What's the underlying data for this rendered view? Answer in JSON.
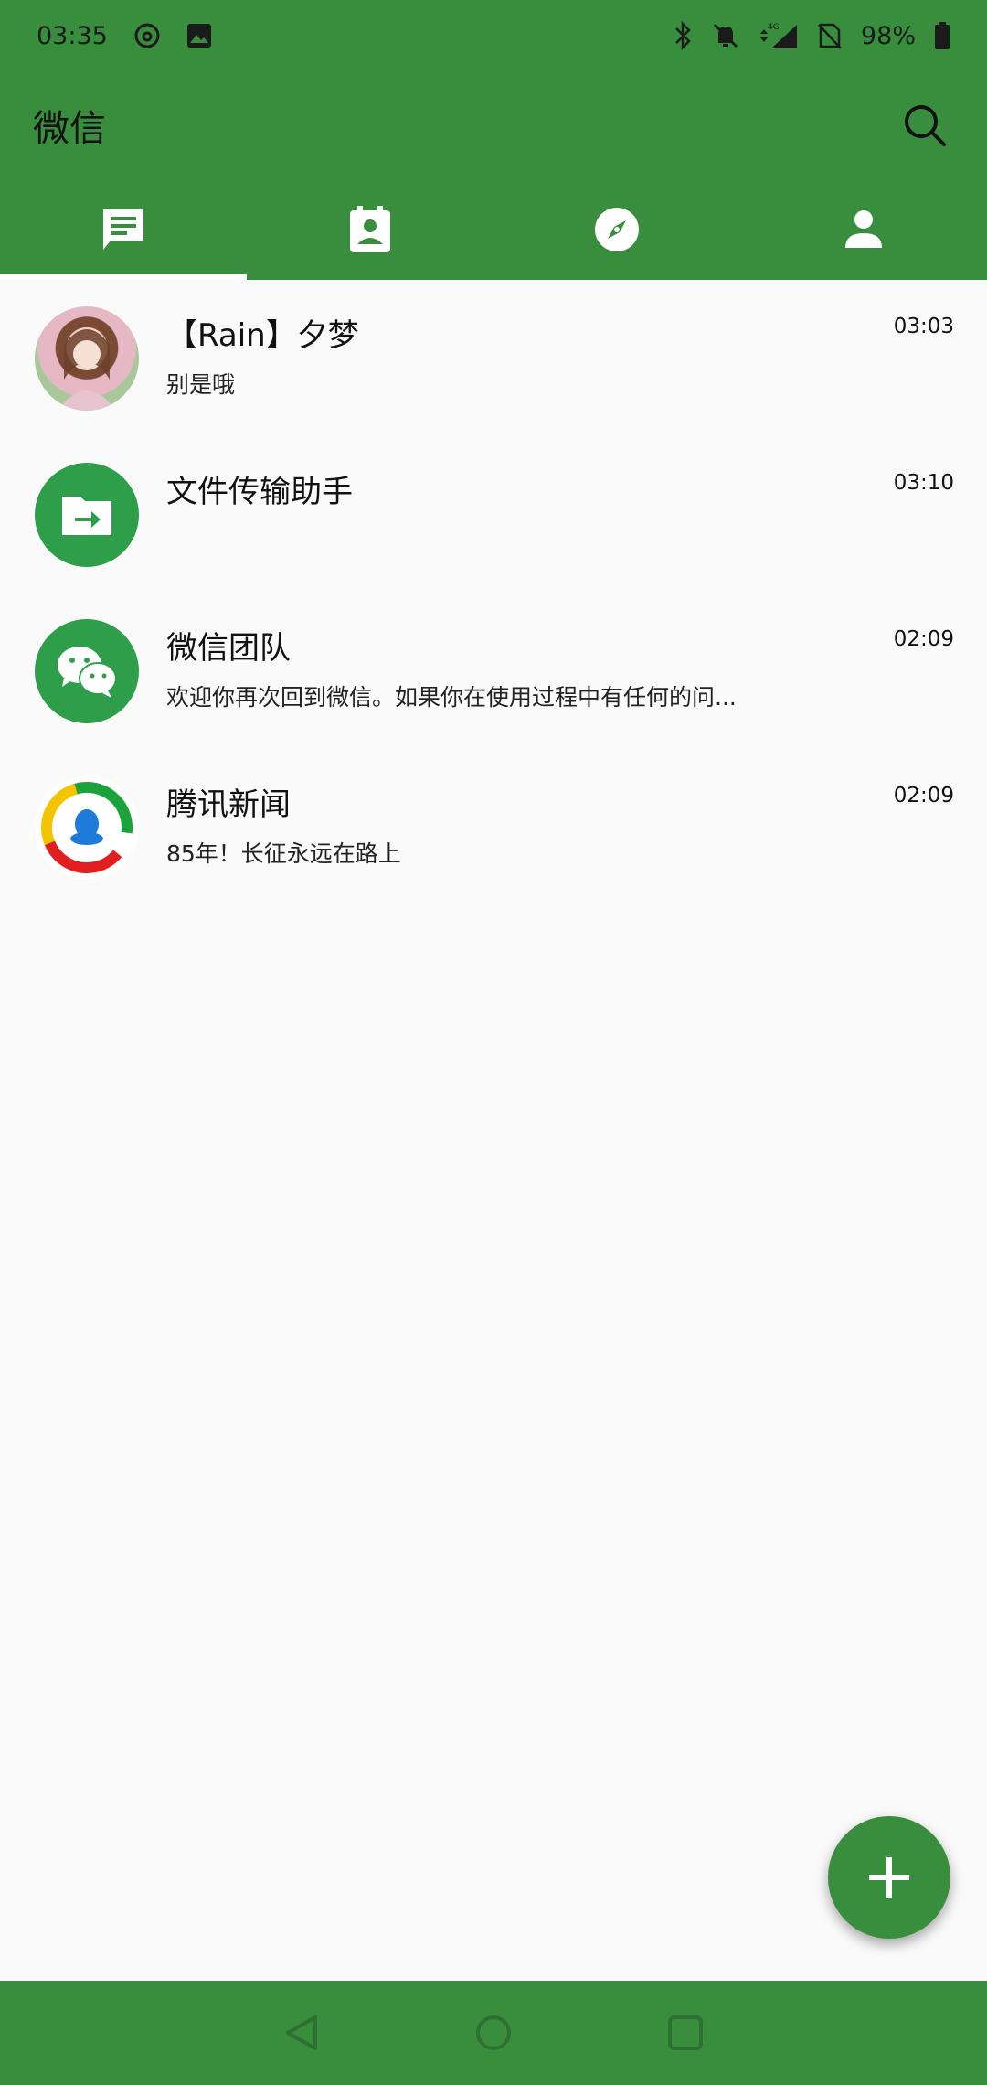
{
  "status_bar": {
    "time": "03:35",
    "battery": "98%",
    "network": "4G"
  },
  "app_bar": {
    "title": "微信"
  },
  "tabs": [
    {
      "name": "chats",
      "icon": "chat-icon",
      "active": true
    },
    {
      "name": "contacts",
      "icon": "contacts-icon",
      "active": false
    },
    {
      "name": "discover",
      "icon": "compass-icon",
      "active": false
    },
    {
      "name": "me",
      "icon": "person-icon",
      "active": false
    }
  ],
  "chats": [
    {
      "name": "【Rain】夕梦",
      "message": "别是哦",
      "time": "03:03",
      "avatar": "photo-avatar"
    },
    {
      "name": "文件传输助手",
      "message": "",
      "time": "03:10",
      "avatar": "file-transfer-icon"
    },
    {
      "name": "微信团队",
      "message": "欢迎你再次回到微信。如果你在使用过程中有任何的问...",
      "time": "02:09",
      "avatar": "wechat-logo-icon"
    },
    {
      "name": "腾讯新闻",
      "message": "85年！长征永远在路上",
      "time": "02:09",
      "avatar": "tencent-news-logo-icon"
    }
  ],
  "colors": {
    "primary": "#388e3c",
    "avatar_green": "#2e9e4b",
    "background": "#fafafa"
  }
}
